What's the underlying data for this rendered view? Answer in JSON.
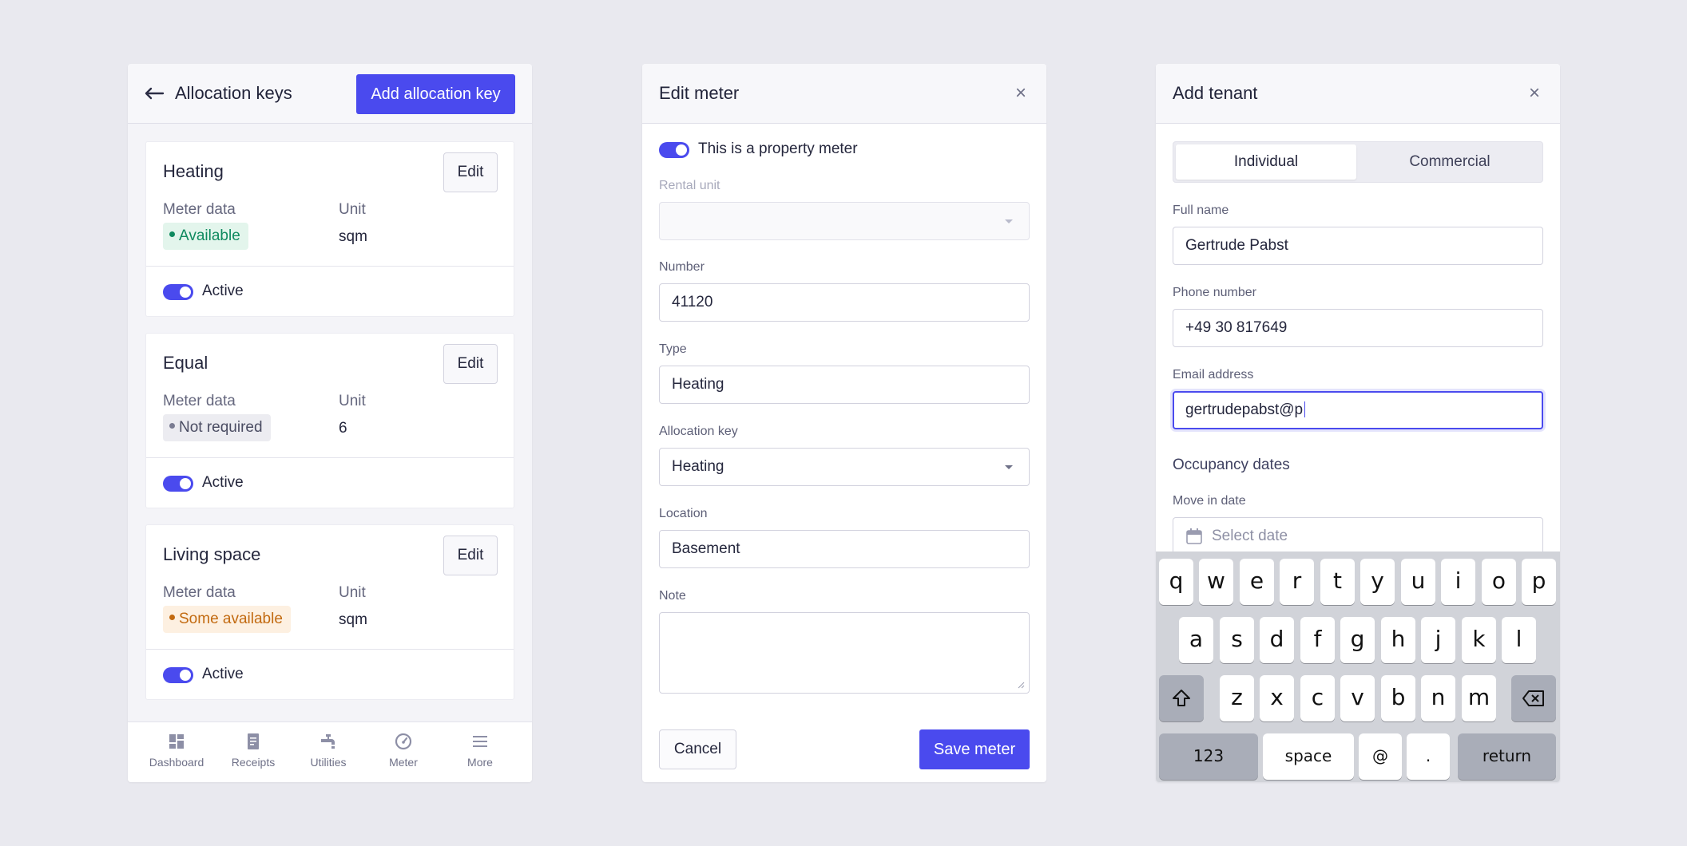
{
  "allocation_keys": {
    "title": "Allocation keys",
    "add_button": "Add allocation key",
    "meter_data_label": "Meter data",
    "unit_label": "Unit",
    "edit_label": "Edit",
    "active_label": "Active",
    "cards": [
      {
        "title": "Heating",
        "badge": "Available",
        "badge_color": "#0f8a5f",
        "badge_bg": "#e3f5ec",
        "unit": "sqm",
        "active": true
      },
      {
        "title": "Equal",
        "badge": "Not required",
        "badge_color": "#4a4c62",
        "badge_bg": "#ececf1",
        "unit": "6",
        "active": true
      },
      {
        "title": "Living space",
        "badge": "Some available",
        "badge_color": "#c26a10",
        "badge_bg": "#fdf0e1",
        "unit": "sqm",
        "active": true
      }
    ],
    "tabs": [
      {
        "label": "Dashboard",
        "icon": "dashboard-icon"
      },
      {
        "label": "Receipts",
        "icon": "receipt-icon"
      },
      {
        "label": "Utilities",
        "icon": "faucet-icon"
      },
      {
        "label": "Meter",
        "icon": "gauge-icon"
      },
      {
        "label": "More",
        "icon": "menu-icon"
      }
    ]
  },
  "edit_meter": {
    "title": "Edit meter",
    "property_meter_label": "This is a property meter",
    "fields": {
      "rental_unit": {
        "label": "Rental unit",
        "value": ""
      },
      "number": {
        "label": "Number",
        "value": "41120"
      },
      "type": {
        "label": "Type",
        "value": "Heating"
      },
      "allocation_key": {
        "label": "Allocation key",
        "value": "Heating"
      },
      "location": {
        "label": "Location",
        "value": "Basement"
      },
      "note": {
        "label": "Note",
        "value": ""
      }
    },
    "cancel_label": "Cancel",
    "save_label": "Save meter"
  },
  "add_tenant": {
    "title": "Add tenant",
    "segments": [
      "Individual",
      "Commercial"
    ],
    "fields": {
      "full_name": {
        "label": "Full name",
        "value": "Gertrude Pabst"
      },
      "phone": {
        "label": "Phone number",
        "value": "+49 30 817649"
      },
      "email": {
        "label": "Email address",
        "value": "gertrudepabst@p"
      }
    },
    "occupancy_title": "Occupancy dates",
    "move_in_label": "Move in date",
    "move_in_placeholder": "Select date"
  },
  "keyboard": {
    "row1": [
      "q",
      "w",
      "e",
      "r",
      "t",
      "y",
      "u",
      "i",
      "o",
      "p"
    ],
    "row2": [
      "a",
      "s",
      "d",
      "f",
      "g",
      "h",
      "j",
      "k",
      "l"
    ],
    "row3": [
      "z",
      "x",
      "c",
      "v",
      "b",
      "n",
      "m"
    ],
    "numbers_key": "123",
    "space_key": "space",
    "at_key": "@",
    "dot_key": ".",
    "return_key": "return"
  },
  "colors": {
    "accent": "#4a4aee",
    "background": "#e9e9ef"
  }
}
